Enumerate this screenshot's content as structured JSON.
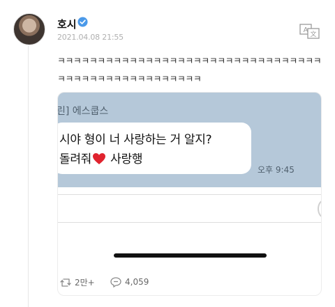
{
  "author": {
    "name": "호시",
    "timestamp": "2021.04.08 21:55"
  },
  "icons": {
    "verified": "verified-badge-icon",
    "translate": "translate-icon",
    "retweet": "retweet-icon",
    "reply": "reply-icon",
    "heart": "heart-emoji-icon"
  },
  "post": {
    "text": "ㅋㅋㅋㅋㅋㅋㅋㅋㅋㅋㅋㅋㅋㅋㅋㅋㅋㅋㅋㅋㅋㅋㅋㅋㅋㅋㅋㅋㅋㅋㅋㅋㅋㅋㅋㅋㅋㅋㅋㅋㅋㅋㅋㅋㅋㅋㅋㅋㅋㅋㅋ"
  },
  "media": {
    "sender": "린] 에스쿱스",
    "message_line1": "시야 형이 너 사랑하는 거 알지?",
    "message_line2_start": "돌려줘",
    "message_line2_end": "사랑행",
    "time": "오후 9:45"
  },
  "stats": {
    "retweets": "2만+",
    "replies": "4,059"
  },
  "colors": {
    "verified": "#4a99e9",
    "chat_background": "#b5c8d9",
    "heart": "#e0232e"
  }
}
